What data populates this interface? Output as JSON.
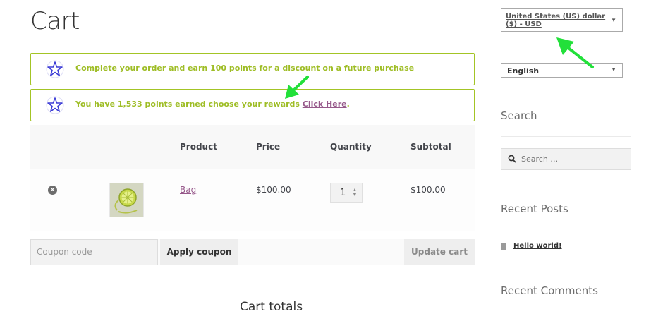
{
  "page": {
    "title": "Cart"
  },
  "notices": [
    {
      "text": "Complete your order and earn 100 points for a discount on a future purchase"
    },
    {
      "text": "You have 1,533 points earned choose your rewards ",
      "link": "Click Here",
      "suffix": "."
    }
  ],
  "cart": {
    "headers": {
      "product": "Product",
      "price": "Price",
      "quantity": "Quantity",
      "subtotal": "Subtotal"
    },
    "items": [
      {
        "remove": "×",
        "name": "Bag",
        "price": "$100.00",
        "quantity": "1",
        "subtotal": "$100.00"
      }
    ],
    "coupon_placeholder": "Coupon code",
    "apply_coupon": "Apply coupon",
    "update_cart": "Update cart",
    "totals_title": "Cart totals"
  },
  "sidebar": {
    "currency": "United States (US) dollar ($) - USD",
    "language": "English",
    "search_title": "Search",
    "search_placeholder": "Search …",
    "recent_posts_title": "Recent Posts",
    "recent_posts": [
      "Hello world!"
    ],
    "recent_comments_title": "Recent Comments"
  },
  "colors": {
    "accent_green": "#9ebd25",
    "link_purple": "#96588a",
    "annotation_arrow": "#22e03a",
    "star_blue": "#3b3bd6"
  }
}
